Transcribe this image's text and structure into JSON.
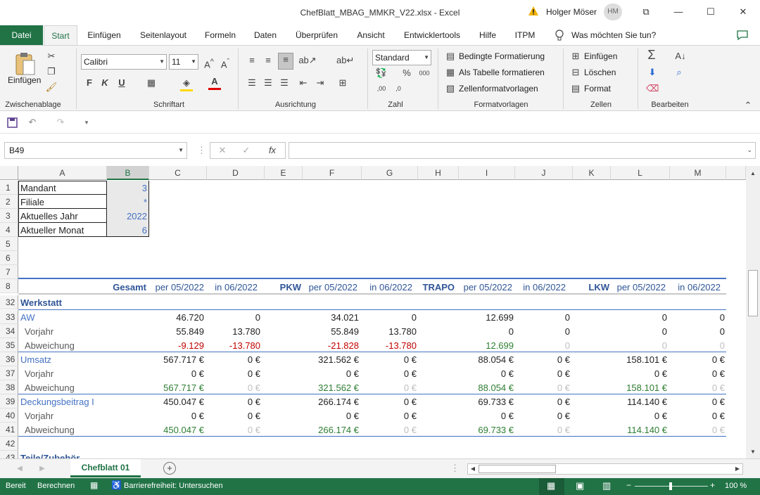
{
  "window": {
    "title": "ChefBlatt_MBAG_MMKR_V22.xlsx  -  Excel",
    "user": "Holger Möser",
    "avatar": "HM",
    "min": "—",
    "max": "☐",
    "close": "✕",
    "restore": "⧉"
  },
  "tabs": [
    "Datei",
    "Start",
    "Einfügen",
    "Seitenlayout",
    "Formeln",
    "Daten",
    "Überprüfen",
    "Ansicht",
    "Entwicklertools",
    "Hilfe",
    "ITPM"
  ],
  "tell_me": "Was möchten Sie tun?",
  "ribbon": {
    "clipboard": {
      "paste": "Einfügen",
      "label": "Zwischenablage"
    },
    "font": {
      "name": "Calibri",
      "size": "11",
      "bold": "F",
      "italic": "K",
      "underline": "U",
      "label": "Schriftart"
    },
    "alignment": {
      "label": "Ausrichtung"
    },
    "number": {
      "format": "Standard",
      "label": "Zahl"
    },
    "styles": {
      "conditional": "Bedingte Formatierung",
      "table": "Als Tabelle formatieren",
      "cell": "Zellenformatvorlagen",
      "label": "Formatvorlagen"
    },
    "cells": {
      "insert": "Einfügen",
      "delete": "Löschen",
      "format": "Format",
      "label": "Zellen"
    },
    "editing": {
      "label": "Bearbeiten"
    }
  },
  "formula_bar": {
    "name_box": "B49",
    "fx": "fx",
    "value": ""
  },
  "columns": [
    "A",
    "B",
    "C",
    "D",
    "E",
    "F",
    "G",
    "H",
    "I",
    "J",
    "K",
    "L",
    "M"
  ],
  "params": [
    {
      "row": "1",
      "label": "Mandant",
      "value": "3"
    },
    {
      "row": "2",
      "label": "Filiale",
      "value": "*"
    },
    {
      "row": "3",
      "label": "Aktuelles Jahr",
      "value": "2022"
    },
    {
      "row": "4",
      "label": "Aktueller Monat",
      "value": "6"
    }
  ],
  "empty_rows": [
    "5",
    "6",
    "7"
  ],
  "header": {
    "row": "8",
    "gesamt": "Gesamt",
    "per1": "per 05/2022",
    "in1": "in 06/2022",
    "pkw": "PKW",
    "per2": "per 05/2022",
    "in2": "in 06/2022",
    "trapo": "TRAPO",
    "per3": "per 05/2022",
    "in3": "in 06/2022",
    "lkw": "LKW",
    "per4": "per 05/2022",
    "in4": "in 06/2022"
  },
  "section": {
    "row": "32",
    "title": "Werkstatt"
  },
  "data_rows": [
    {
      "row": "33",
      "label": "AW",
      "c": "46.720",
      "d": "0",
      "f": "34.021",
      "g": "0",
      "i": "12.699",
      "j": "0",
      "l": "0",
      "m": "0"
    },
    {
      "row": "34",
      "label": "Vorjahr",
      "c": "55.849",
      "d": "13.780",
      "f": "55.849",
      "g": "13.780",
      "i": "0",
      "j": "0",
      "l": "0",
      "m": "0"
    },
    {
      "row": "35",
      "label": "Abweichung",
      "c": "-9.129",
      "d": "-13.780",
      "f": "-21.828",
      "g": "-13.780",
      "i": "12.699",
      "j": "0",
      "l": "0",
      "m": "0"
    },
    {
      "row": "36",
      "label": "Umsatz",
      "c": "567.717 €",
      "d": "0 €",
      "f": "321.562 €",
      "g": "0 €",
      "i": "88.054 €",
      "j": "0 €",
      "l": "158.101 €",
      "m": "0 €"
    },
    {
      "row": "37",
      "label": "Vorjahr",
      "c": "0 €",
      "d": "0 €",
      "f": "0 €",
      "g": "0 €",
      "i": "0 €",
      "j": "0 €",
      "l": "0 €",
      "m": "0 €"
    },
    {
      "row": "38",
      "label": "Abweichung",
      "c": "567.717 €",
      "d": "0 €",
      "f": "321.562 €",
      "g": "0 €",
      "i": "88.054 €",
      "j": "0 €",
      "l": "158.101 €",
      "m": "0 €"
    },
    {
      "row": "39",
      "label": "Deckungsbeitrag I",
      "c": "450.047 €",
      "d": "0 €",
      "f": "266.174 €",
      "g": "0 €",
      "i": "69.733 €",
      "j": "0 €",
      "l": "114.140 €",
      "m": "0 €"
    },
    {
      "row": "40",
      "label": "Vorjahr",
      "c": "0 €",
      "d": "0 €",
      "f": "0 €",
      "g": "0 €",
      "i": "0 €",
      "j": "0 €",
      "l": "0 €",
      "m": "0 €"
    },
    {
      "row": "41",
      "label": "Abweichung",
      "c": "450.047 €",
      "d": "0 €",
      "f": "266.174 €",
      "g": "0 €",
      "i": "69.733 €",
      "j": "0 €",
      "l": "114.140 €",
      "m": "0 €"
    }
  ],
  "row42": "42",
  "row43": {
    "row": "43",
    "label": "Teile/Zubehör"
  },
  "sheet_tab": "Chefblatt 01",
  "status": {
    "ready": "Bereit",
    "calc": "Berechnen",
    "accessibility": "Barrierefreiheit: Untersuchen",
    "zoom": "100 %"
  }
}
